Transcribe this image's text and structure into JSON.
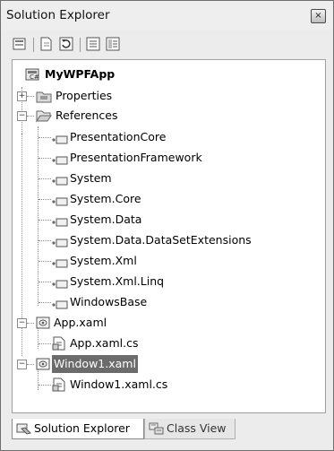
{
  "window": {
    "title": "Solution Explorer",
    "close_glyph": "×"
  },
  "toolbar": {
    "buttons": [
      "properties-icon",
      "show-all-files-icon",
      "refresh-icon",
      "view-code-icon",
      "view-designer-icon"
    ]
  },
  "tree": {
    "project": "MyWPFApp",
    "properties": "Properties",
    "references": "References",
    "refs": [
      "PresentationCore",
      "PresentationFramework",
      "System",
      "System.Core",
      "System.Data",
      "System.Data.DataSetExtensions",
      "System.Xml",
      "System.Xml.Linq",
      "WindowsBase"
    ],
    "app_xaml": "App.xaml",
    "app_xaml_cs": "App.xaml.cs",
    "window1_xaml": "Window1.xaml",
    "window1_xaml_cs": "Window1.xaml.cs",
    "expand_plus": "+",
    "collapse_minus": "−"
  },
  "tabs": {
    "solution_explorer": "Solution Explorer",
    "class_view": "Class View"
  },
  "colors": {
    "selection": "#6b6b6b",
    "background": "#ececec"
  }
}
